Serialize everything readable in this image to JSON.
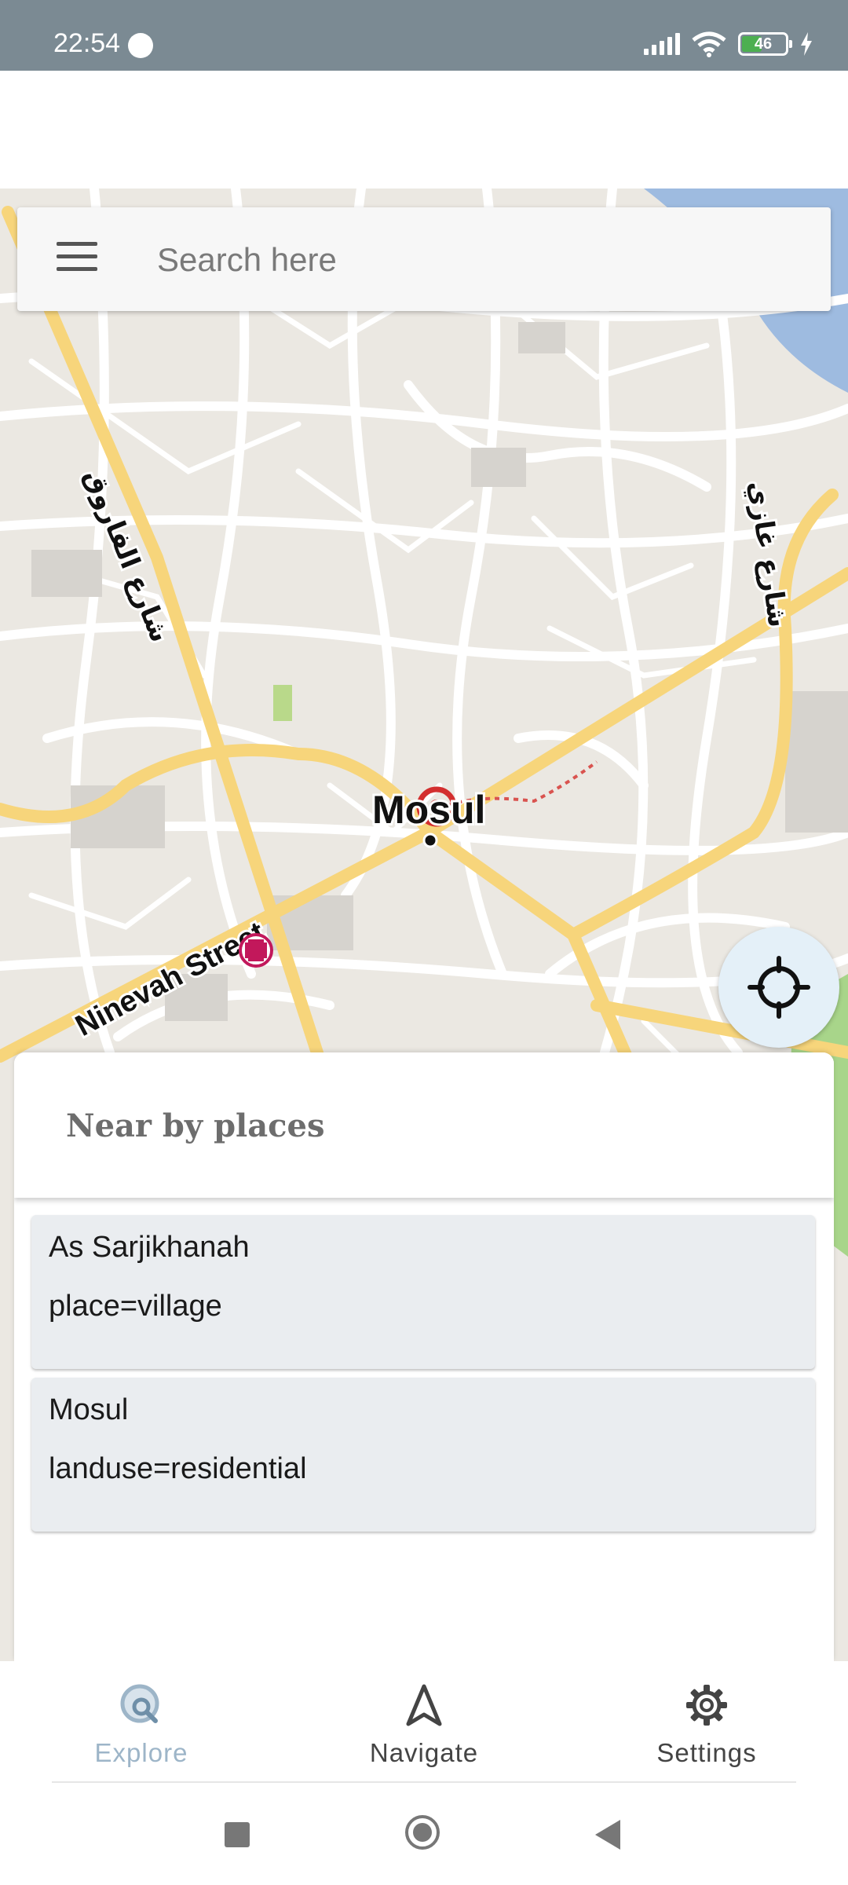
{
  "status_bar": {
    "time": "22:54",
    "battery": "46",
    "battery_level": 0.46
  },
  "search": {
    "placeholder": "Search here"
  },
  "map": {
    "labels": {
      "city": "Mosul",
      "street_ninevah": "Ninevah Street",
      "street_farouq": "شارع الفاروق",
      "street_ghazi": "شارع غازي"
    }
  },
  "nearby": {
    "title": "Near by places",
    "places": [
      {
        "name": "As Sarjikhanah",
        "tag": "place=village"
      },
      {
        "name": "Mosul",
        "tag": "landuse=residential"
      }
    ]
  },
  "bottom_nav": {
    "items": [
      {
        "label": "Explore",
        "icon": "explore-icon",
        "active": true
      },
      {
        "label": "Navigate",
        "icon": "navigate-arrow-icon",
        "active": false
      },
      {
        "label": "Settings",
        "icon": "gear-icon",
        "active": false
      }
    ]
  },
  "colors": {
    "status_bar": "#7b8a93",
    "map_background": "#ebe8e2",
    "major_road": "#f7d57b",
    "water": "#9ebbe0",
    "park": "#a8d58a",
    "card_background": "#eaedf0",
    "locate_button": "#e4f0f8",
    "nav_active": "#9db5c8"
  }
}
